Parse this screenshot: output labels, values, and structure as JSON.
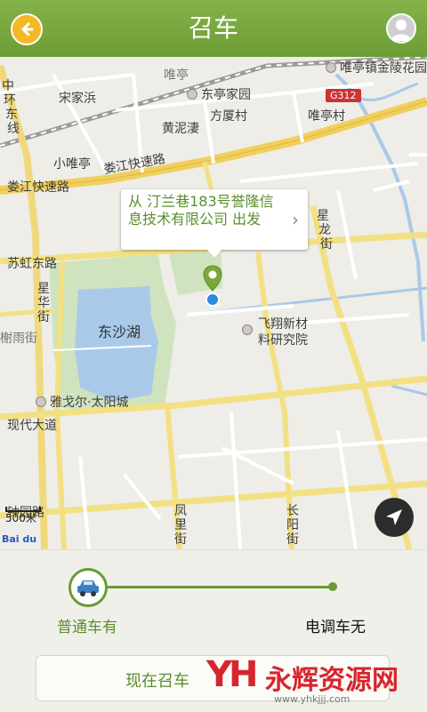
{
  "header": {
    "title": "召车"
  },
  "map": {
    "labels": {
      "weiting": "唯亭",
      "weiting_town": "唯亭镇金陵花园",
      "songjiabang": "宋家浜",
      "dongting": "东亭家园",
      "zhonghuan_1": "中",
      "zhonghuan_2": "环",
      "zhonghuan_3": "东",
      "zhonghuan_4": "线",
      "fangsha": "方厦村",
      "huangnilou": "黄泥淒",
      "weitingcun": "唯亭村",
      "xiaoweiting": "小唯亭",
      "loujiang_road_1": "娄江快速路",
      "loujiang_road_2": "娄江快速路",
      "suhong": "苏虹东路",
      "xinglong_1": "星",
      "xinglong_2": "龙",
      "xinglong_3": "街",
      "xinghua_1": "星",
      "xinghua_2": "华",
      "xinghua_3": "街",
      "dongshahu": "东沙湖",
      "feixiang_1": "飞翔新材",
      "feixiang_2": "料研究院",
      "shuyu": "榭雨街",
      "yage": "雅戈尔·太阳城",
      "xiandai": "现代大道",
      "zhongyuan": "钟园路",
      "fengli_1": "凤",
      "fengli_2": "里",
      "fengli_3": "街",
      "changyang_1": "长",
      "changyang_2": "阳",
      "changyang_3": "街",
      "g312": "G312"
    },
    "bubble_text": "从 汀兰巷183号誉隆信息技术有限公司 出发",
    "bubble_chevron": "›",
    "scale": "500米",
    "baidu": "Bai du"
  },
  "panel": {
    "option_left": "普通车有",
    "option_right": "电调车无",
    "call_button": "现在召车"
  },
  "watermark": {
    "logo": "YH",
    "name": "永辉资源网",
    "url": "www.yhkjjj.com"
  }
}
